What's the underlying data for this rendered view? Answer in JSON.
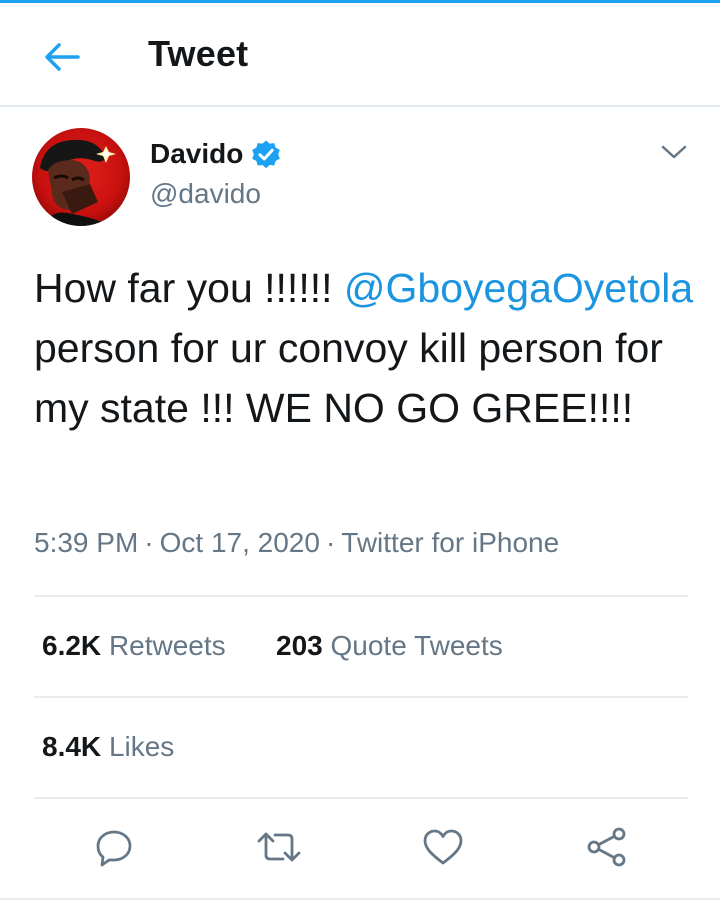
{
  "header": {
    "title": "Tweet",
    "back_icon": "arrow-left-icon"
  },
  "author": {
    "name": "Davido",
    "handle": "@davido",
    "verified": true
  },
  "tweet": {
    "text_part1": "How far you !!!!!! ",
    "mention": "@GboyegaOyetola",
    "text_part2": " person for ur convoy  kill person for my state !!! WE NO GO GREE!!!!"
  },
  "meta": {
    "time": "5:39 PM",
    "separator": "·",
    "date": "Oct 17, 2020",
    "source": "Twitter for iPhone"
  },
  "stats": {
    "retweets_count": "6.2K",
    "retweets_label": "Retweets",
    "quotes_count": "203",
    "quotes_label": "Quote Tweets",
    "likes_count": "8.4K",
    "likes_label": "Likes"
  },
  "actions": [
    "reply-icon",
    "retweet-icon",
    "like-icon",
    "share-icon"
  ],
  "colors": {
    "accent": "#1da1f2",
    "mention": "#1b95e0",
    "text": "#14171a",
    "secondary": "#657786",
    "divider": "#e6ecf0"
  }
}
